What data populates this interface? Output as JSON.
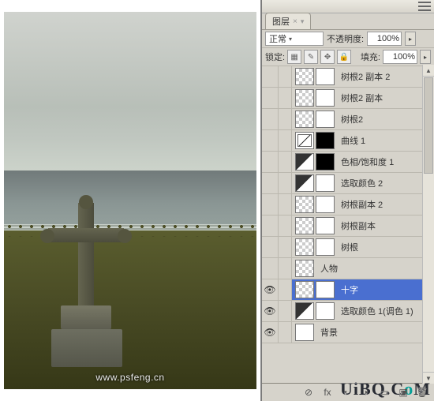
{
  "canvas": {
    "watermark": "www.psfeng.cn"
  },
  "panel": {
    "tab_label": "图层",
    "blend_mode": "正常",
    "opacity": {
      "label": "不透明度:",
      "value": "100%"
    },
    "lock": {
      "label": "锁定:"
    },
    "fill": {
      "label": "填充:",
      "value": "100%"
    }
  },
  "layers": [
    {
      "name": "树根2 副本 2",
      "visible": false,
      "selected": false,
      "thumbs": [
        "checker",
        "mask"
      ]
    },
    {
      "name": "树根2 副本",
      "visible": false,
      "selected": false,
      "thumbs": [
        "checker",
        "mask"
      ]
    },
    {
      "name": "树根2",
      "visible": false,
      "selected": false,
      "thumbs": [
        "checker",
        "mask"
      ]
    },
    {
      "name": "曲线 1",
      "visible": false,
      "selected": false,
      "thumbs": [
        "curves",
        "mask black"
      ]
    },
    {
      "name": "色相/饱和度 1",
      "visible": false,
      "selected": false,
      "thumbs": [
        "adj",
        "mask black"
      ]
    },
    {
      "name": "选取颜色 2",
      "visible": false,
      "selected": false,
      "thumbs": [
        "adj",
        "mask"
      ]
    },
    {
      "name": "树根副本 2",
      "visible": false,
      "selected": false,
      "thumbs": [
        "checker",
        "mask"
      ]
    },
    {
      "name": "树根副本",
      "visible": false,
      "selected": false,
      "thumbs": [
        "checker",
        "mask"
      ]
    },
    {
      "name": "树根",
      "visible": false,
      "selected": false,
      "thumbs": [
        "checker",
        "mask"
      ]
    },
    {
      "name": "人物",
      "visible": false,
      "selected": false,
      "thumbs": [
        "checker"
      ]
    },
    {
      "name": "十字",
      "visible": true,
      "selected": true,
      "thumbs": [
        "checker",
        "mask"
      ]
    },
    {
      "name": "选取颜色 1(调色 1)",
      "visible": true,
      "selected": false,
      "thumbs": [
        "adj",
        "mask"
      ]
    },
    {
      "name": "背景",
      "visible": true,
      "selected": false,
      "thumbs": [
        "mask"
      ]
    }
  ],
  "logo": {
    "text": "UiBQ.C",
    "accent": "o",
    "suffix": "M"
  }
}
